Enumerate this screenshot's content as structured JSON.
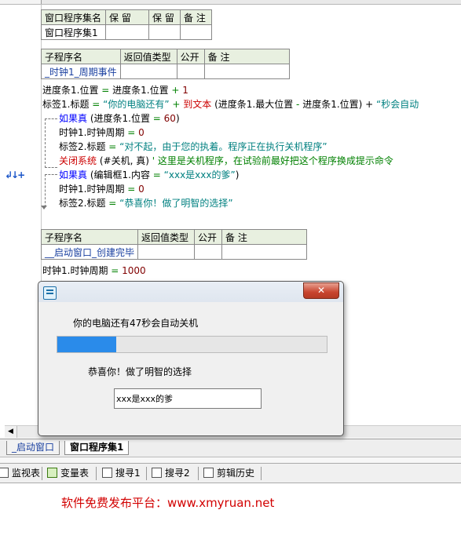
{
  "main_table": {
    "headers": [
      "窗口程序集名",
      "保 留",
      "保 留",
      "备 注"
    ],
    "row": [
      "窗口程序集1",
      "",
      "",
      ""
    ]
  },
  "sub1": {
    "headers": [
      "子程序名",
      "返回值类型",
      "公开",
      "备 注"
    ],
    "row": [
      "_时钟1_周期事件",
      "",
      "",
      ""
    ]
  },
  "sub2": {
    "headers": [
      "子程序名",
      "返回值类型",
      "公开",
      "备 注"
    ],
    "row": [
      "__启动窗口_创建完毕",
      "",
      "",
      ""
    ]
  },
  "code": {
    "l1": [
      "进度条1.位置",
      " = ",
      "进度条1.位置",
      " + ",
      "1"
    ],
    "l2": [
      "标签1.标题",
      " = ",
      "“你的电脑还有”",
      " + ",
      "到文本",
      " (进度条1.最大位置",
      " - ",
      "进度条1.位置",
      ") + ",
      "“秒会自动"
    ],
    "l3": [
      "如果真",
      " (进度条1.位置",
      " = ",
      "60",
      ")"
    ],
    "l4": [
      "时钟1.时钟周期",
      " = ",
      "0"
    ],
    "l5": [
      "标签2.标题",
      " = ",
      "“对不起，由于您的执着。程序正在执行关机程序”"
    ],
    "l6": [
      "关闭系统",
      " (#关机, 真)",
      "  ' 这里是关机程序，在试验前最好把这个程序换成提示命令"
    ],
    "l7": [
      "如果真",
      " (编辑框1.内容",
      " = ",
      "“xxx是xxx的爹”",
      ")"
    ],
    "l8": [
      "时钟1.时钟周期",
      " = ",
      "0"
    ],
    "l9": [
      "标签2.标题",
      " = ",
      "“恭喜你！做了明智的选择”"
    ],
    "l10": [
      "时钟1.时钟周期",
      " = ",
      "1000"
    ]
  },
  "gutter_icon": "↲↓+",
  "dialog": {
    "icon": "app-icon",
    "close_label": "✕",
    "label1": "你的电脑还有47秒会自动关机",
    "progress": 0.22,
    "label2": "恭喜你！做了明智的选择",
    "input_value": "xxx是xxx的爹"
  },
  "doc_tabs": [
    "_启动窗口",
    "窗口程序集1"
  ],
  "bottom_tabs": [
    "监视表",
    "变量表",
    "搜寻1",
    "搜寻2",
    "剪辑历史"
  ],
  "footer": "软件免费发布平台：www.xmyruan.net",
  "colors": {
    "progress": "#2a8bea",
    "footer": "#d20000",
    "keyword": "#0000ff",
    "string": "#008080"
  }
}
